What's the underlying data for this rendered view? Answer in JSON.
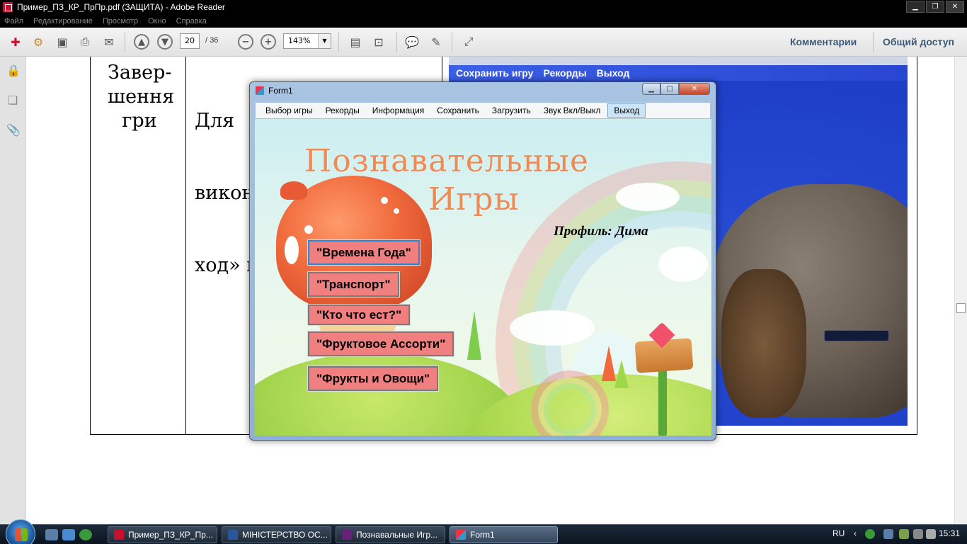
{
  "window": {
    "title": "Пример_ПЗ_КР_ПрПр.pdf (ЗАЩИТА) - Adobe Reader"
  },
  "menu": [
    "Файл",
    "Редактирование",
    "Просмотр",
    "Окно",
    "Справка"
  ],
  "toolbar": {
    "page_current": "20",
    "page_total": "/ 36",
    "zoom": "143%",
    "comments": "Комментарии",
    "share": "Общий доступ"
  },
  "document": {
    "cell_left": [
      "Завер-",
      "шення",
      "гри"
    ],
    "cell_right": [
      "Для   виходу   з   гри   слід",
      "викон",
      "ход» п"
    ],
    "shot_menu": [
      "Сохранить игру",
      "Рекорды",
      "Выход"
    ]
  },
  "form": {
    "title": "Form1",
    "menu": [
      "Выбор игры",
      "Рекорды",
      "Информация",
      "Сохранить",
      "Загрузить",
      "Звук Вкл/Выкл",
      "Выход"
    ],
    "active_menu": "Выход",
    "heading_line1": "Познавательные",
    "heading_line2": "Игры",
    "profile": "Профиль: Дима",
    "buttons": [
      "\"Времена Года\"",
      "\"Транспорт\"",
      "\"Кто что ест?\"",
      "\"Фруктовое Ассорти\"",
      "\"Фрукты и Овощи\""
    ]
  },
  "taskbar": {
    "tasks": [
      "Пример_ПЗ_КР_Пр...",
      "МІНІСТЕРСТВО ОС...",
      "Познавальные Игр...",
      "Form1"
    ],
    "lang": "RU",
    "clock": "15:31"
  },
  "colors": {
    "accent": "#3b5a7a",
    "button_bg": "#f08080",
    "heading": "#f08a55",
    "doc_shot_bg": "#1f3fc8"
  }
}
